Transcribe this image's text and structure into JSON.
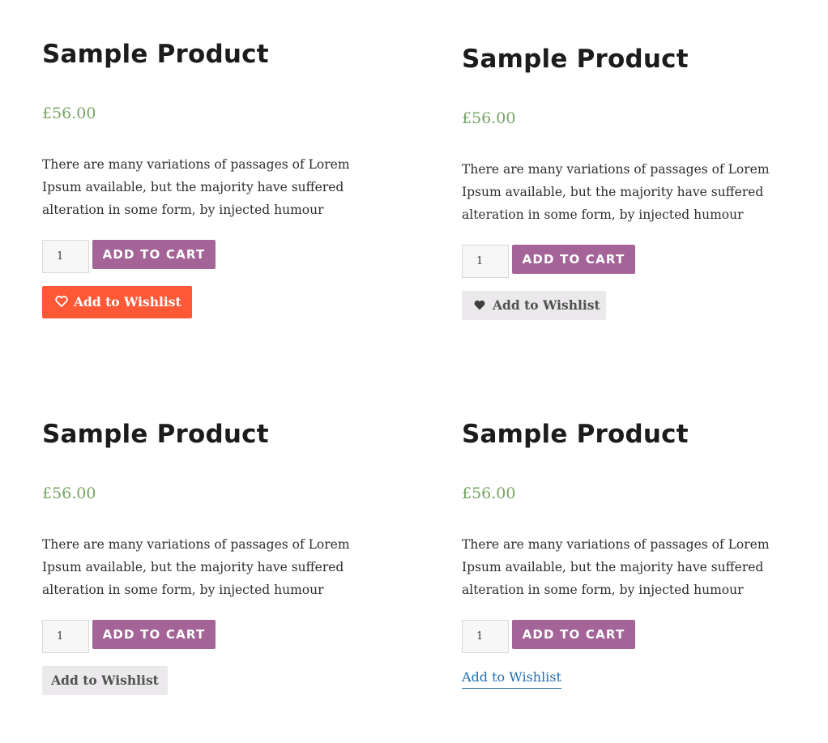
{
  "colors": {
    "price": "#77a464",
    "add_to_cart_bg": "#a46497",
    "wishlist_primary_bg": "#ff5837",
    "wishlist_secondary_bg": "#ebe9eb",
    "wishlist_link": "#2271b1"
  },
  "products": [
    {
      "title": "Sample Product",
      "price": "£56.00",
      "description": "There are many variations of passages of Lorem Ipsum available, but the majority have suffered alteration in some form, by injected humour",
      "quantity": "1",
      "add_to_cart_label": "ADD TO CART",
      "wishlist_label": "Add to Wishlist",
      "wishlist_icon": "heart-outline-icon"
    },
    {
      "title": "Sample Product",
      "price": "£56.00",
      "description": "There are many variations of passages of Lorem Ipsum available, but the majority have suffered alteration in some form, by injected humour",
      "quantity": "1",
      "add_to_cart_label": "ADD TO CART",
      "wishlist_label": "Add to Wishlist",
      "wishlist_icon": "heart-icon"
    },
    {
      "title": "Sample Product",
      "price": "£56.00",
      "description": "There are many variations of passages of Lorem Ipsum available, but the majority have suffered alteration in some form, by injected humour",
      "quantity": "1",
      "add_to_cart_label": "ADD TO CART",
      "wishlist_label": "Add to Wishlist"
    },
    {
      "title": "Sample Product",
      "price": "£56.00",
      "description": "There are many variations of passages of Lorem Ipsum available, but the majority have suffered alteration in some form, by injected humour",
      "quantity": "1",
      "add_to_cart_label": "ADD TO CART",
      "wishlist_label": "Add to Wishlist"
    }
  ]
}
